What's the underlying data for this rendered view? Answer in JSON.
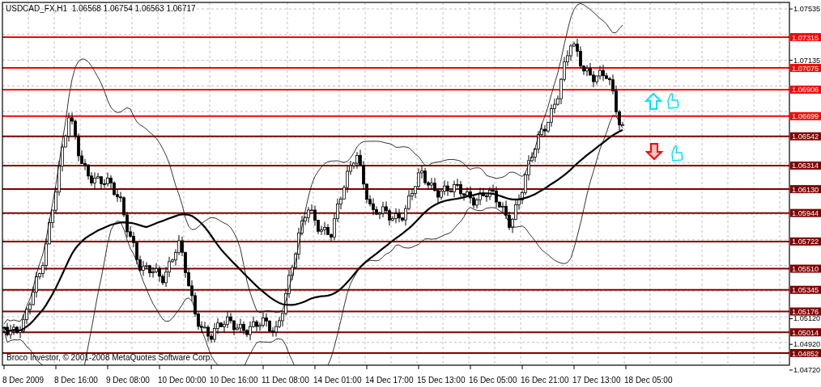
{
  "header": {
    "symbol": "USDCAD_FX,H1",
    "quotes": [
      "1.06568",
      "1.06754",
      "1.06563",
      "1.06717"
    ]
  },
  "price_axis": {
    "ticks": [
      "1.07535",
      "1.07135",
      "1.05120",
      "1.04920",
      "1.04720"
    ]
  },
  "price_levels": [
    {
      "label": "1.07315",
      "color": "#ff0000"
    },
    {
      "label": "1.07075",
      "color": "#ff0000"
    },
    {
      "label": "1.06906",
      "color": "#ff0000"
    },
    {
      "label": "1.06699",
      "color": "#ff0000"
    },
    {
      "label": "1.06542",
      "color": "#800000"
    },
    {
      "label": "1.06314",
      "color": "#800000"
    },
    {
      "label": "1.06130",
      "color": "#800000"
    },
    {
      "label": "1.05944",
      "color": "#800000"
    },
    {
      "label": "1.05722",
      "color": "#800000"
    },
    {
      "label": "1.05510",
      "color": "#800000"
    },
    {
      "label": "1.05345",
      "color": "#800000"
    },
    {
      "label": "1.05176",
      "color": "#800000"
    },
    {
      "label": "1.05014",
      "color": "#800000"
    },
    {
      "label": "1.04852",
      "color": "#800000"
    }
  ],
  "time_axis": {
    "labels": [
      "8 Dec 2009",
      "8 Dec 16:00",
      "9 Dec 08:00",
      "10 Dec 00:00",
      "10 Dec 16:00",
      "11 Dec 08:00",
      "14 Dec 01:00",
      "14 Dec 17:00",
      "15 Dec 13:00",
      "16 Dec 05:00",
      "16 Dec 21:00",
      "17 Dec 13:00",
      "18 Dec 05:00"
    ]
  },
  "copyright": "Broco Investor, © 2001-2008 MetaQuotes Software Corp."
}
